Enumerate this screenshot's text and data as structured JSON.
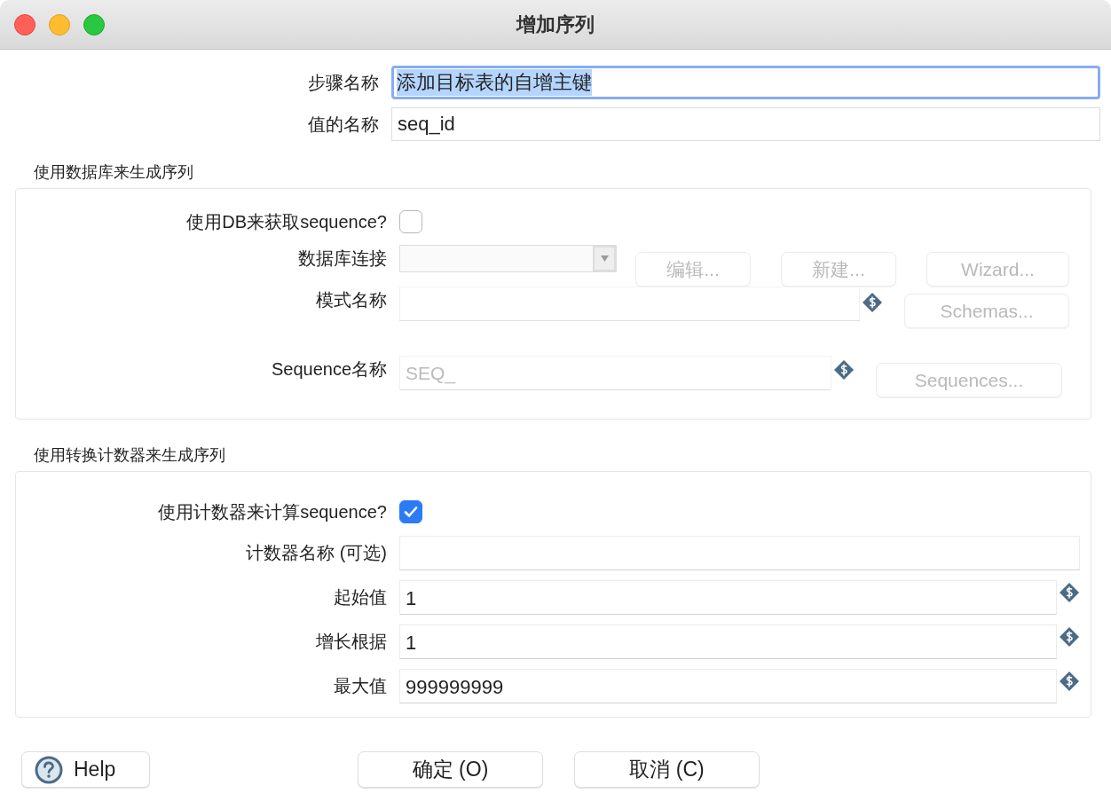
{
  "window": {
    "title": "增加序列"
  },
  "top_fields": [
    {
      "label": "步骤名称",
      "value": "添加目标表的自增主键",
      "focused": true
    },
    {
      "label": "值的名称",
      "value": "seq_id",
      "focused": false
    }
  ],
  "db_section": {
    "title": "使用数据库来生成序列",
    "use_db": {
      "label": "使用DB来获取sequence?",
      "checked": false
    },
    "connection": {
      "label": "数据库连接",
      "disabled": true,
      "buttons": [
        {
          "label": "编辑...",
          "disabled": true
        },
        {
          "label": "新建...",
          "disabled": true
        },
        {
          "label": "Wizard...",
          "disabled": true
        }
      ]
    },
    "schema": {
      "label": "模式名称",
      "disabled": true,
      "button": {
        "label": "Schemas...",
        "disabled": true
      }
    },
    "sequence": {
      "label": "Sequence名称",
      "placeholder": "SEQ_",
      "disabled": true,
      "button": {
        "label": "Sequences...",
        "disabled": true
      }
    }
  },
  "counter_section": {
    "title": "使用转换计数器来生成序列",
    "use_counter": {
      "label": "使用计数器来计算sequence?",
      "checked": true
    },
    "fields": [
      {
        "label": "计数器名称 (可选)",
        "variable": false
      },
      {
        "label": "起始值",
        "value": "1",
        "variable": true
      },
      {
        "label": "增长根据",
        "value": "1",
        "variable": true
      },
      {
        "label": "最大值",
        "value": "999999999",
        "variable": true
      }
    ]
  },
  "buttons": [
    {
      "kind": "help",
      "label": "Help"
    },
    {
      "kind": "ok",
      "label": "确定 (O)"
    },
    {
      "kind": "cancel",
      "label": "取消 (C)"
    }
  ]
}
